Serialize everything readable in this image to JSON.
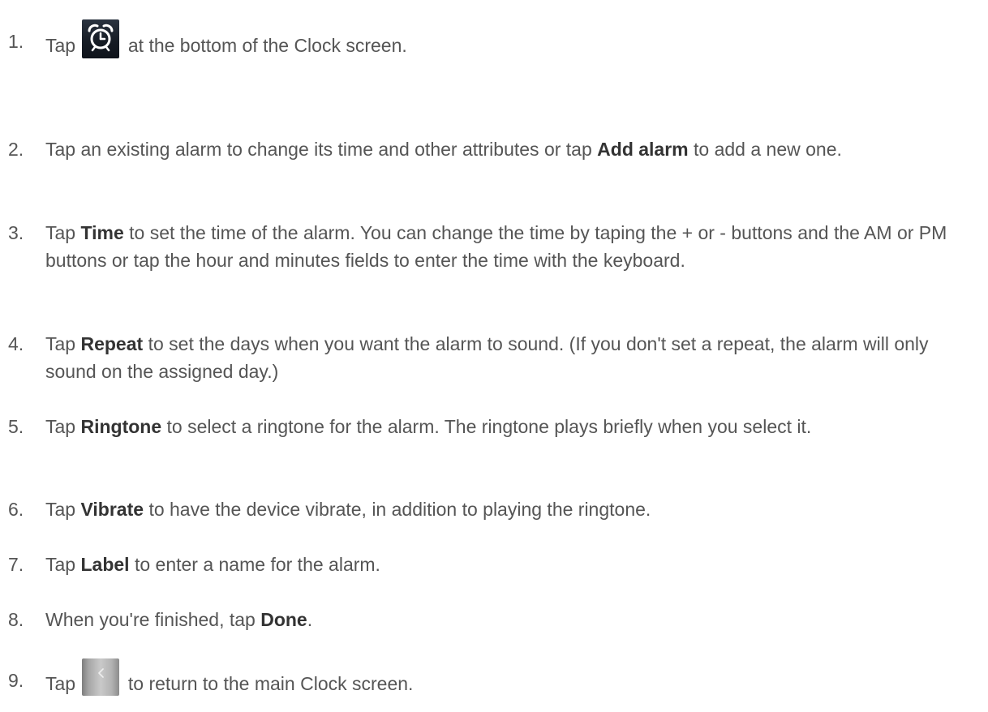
{
  "icons": {
    "alarm": "alarm-clock-icon",
    "back": "back-arrow-icon"
  },
  "steps": [
    {
      "num": "1.",
      "pre": "Tap",
      "post": "at the bottom of the Clock screen."
    },
    {
      "num": "2.",
      "pre": "Tap an existing alarm to change its time and other attributes or tap",
      "bold": "Add alarm",
      "post": "to add a new one."
    },
    {
      "num": "3.",
      "pre": "Tap",
      "bold": "Time",
      "post": "to set the time of the alarm. You can change the time by taping the + or - buttons and the AM or PM buttons or tap the hour and minutes fields to enter the time with the keyboard."
    },
    {
      "num": "4.",
      "pre": "Tap",
      "bold": "Repeat",
      "post": "to set the days when you want the alarm to sound. (If you don't set a repeat, the alarm will only sound on the assigned day.)"
    },
    {
      "num": "5.",
      "pre": "Tap",
      "bold": "Ringtone",
      "post": "to select a ringtone for the alarm. The ringtone plays briefly when you select it."
    },
    {
      "num": "6.",
      "pre": "Tap",
      "bold": "Vibrate",
      "post": "to have the device vibrate, in addition to playing the ringtone."
    },
    {
      "num": "7.",
      "pre": "Tap",
      "bold": "Label",
      "post": "to enter a name for the alarm."
    },
    {
      "num": "8.",
      "pre": "When you're finished, tap",
      "bold": "Done",
      "post": "."
    },
    {
      "num": "9.",
      "pre": "Tap",
      "post": "to return to the main Clock screen."
    }
  ]
}
